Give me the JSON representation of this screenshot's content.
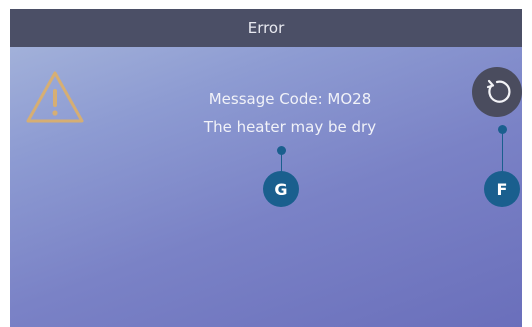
{
  "header": {
    "title": "Error"
  },
  "message": {
    "code_line": "Message Code: MO28",
    "description": "The heater may be dry"
  },
  "icons": {
    "warning": "warning-triangle-icon",
    "refresh": "refresh-icon"
  },
  "callouts": {
    "message_label": "G",
    "refresh_label": "F"
  },
  "colors": {
    "header_bg": "#4b4f66",
    "warning_icon": "#e2b062",
    "callout": "#1a5f8e",
    "refresh_button_bg": "#4a4c5e"
  }
}
